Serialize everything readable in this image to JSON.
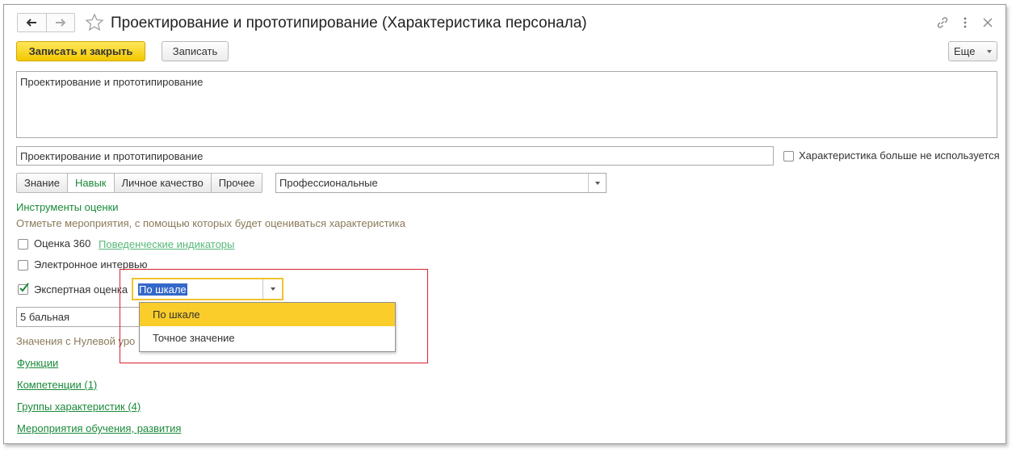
{
  "window": {
    "title": "Проектирование и прототипирование (Характеристика персонала)"
  },
  "toolbar": {
    "save_close_label": "Записать и закрыть",
    "save_label": "Записать",
    "more_label": "Еще"
  },
  "form": {
    "description_value": "Проектирование и прототипирование",
    "name_value": "Проектирование и прототипирование",
    "not_used_label": "Характеристика больше не используется",
    "tabs": [
      {
        "label": "Знание",
        "active": false
      },
      {
        "label": "Навык",
        "active": true
      },
      {
        "label": "Личное качество",
        "active": false
      },
      {
        "label": "Прочее",
        "active": false
      }
    ],
    "category_value": "Профессиональные",
    "assessment_tools_heading": "Инструменты оценки",
    "assessment_hint": "Отметьте мероприятия, с помощью которых будет оцениваться характеристика",
    "eval360_label": "Оценка 360",
    "eval360_checked": false,
    "behavior_indicators_link": "Поведенческие индикаторы",
    "interview_label": "Электронное интервью",
    "interview_checked": false,
    "expert_label": "Экспертная оценка",
    "expert_checked": true,
    "expert_mode_value": "По шкале",
    "scale_value": "5 бальная",
    "zero_level_text": "Значения с Нулевой уро",
    "dropdown_options": [
      "По шкале",
      "Точное значение"
    ],
    "dropdown_selected_index": 0
  },
  "links": {
    "functions": "Функции",
    "competencies": "Компетенции (1)",
    "char_groups": "Группы характеристик (4)",
    "training_events": "Мероприятия обучения, развития"
  },
  "colors": {
    "primary_button": "#f2c800",
    "link_green": "#1a8a3a",
    "highlight_red": "#d9212e",
    "dropdown_selected": "#fbcd2a",
    "text_selection": "#3468c9"
  }
}
